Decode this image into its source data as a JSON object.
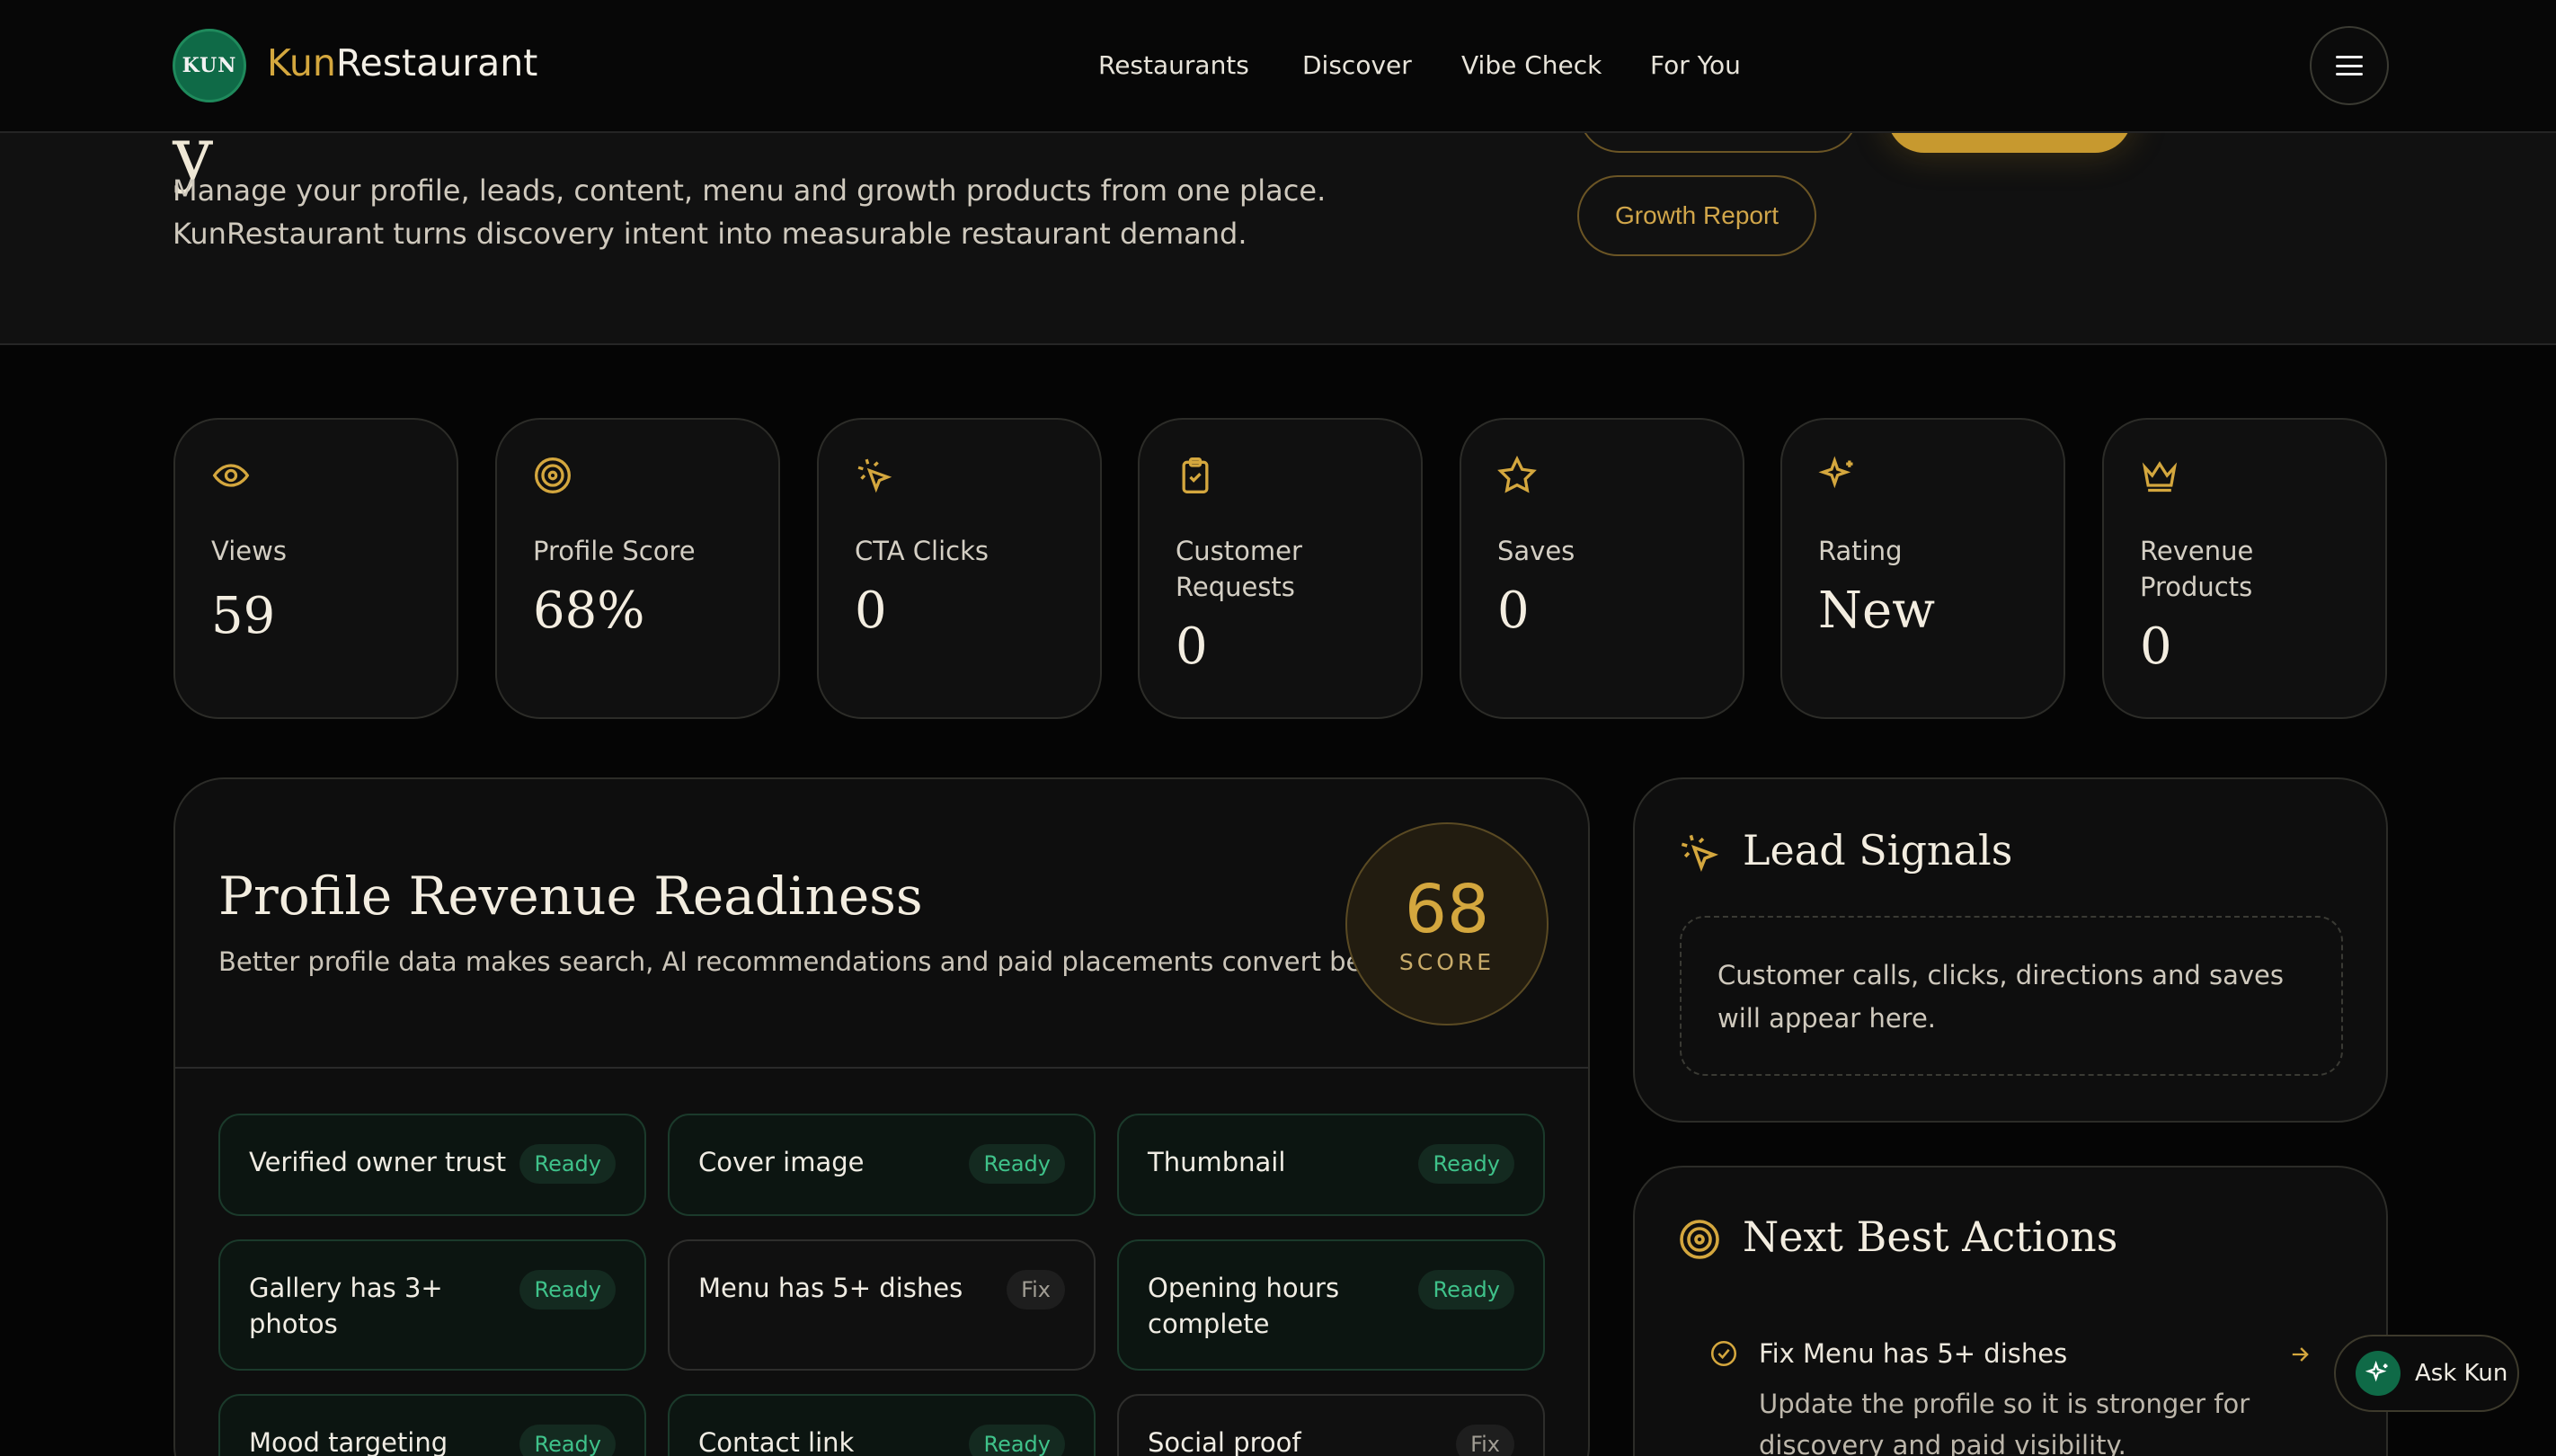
{
  "header": {
    "logo_text": "KUN",
    "brand_kun": "Kun",
    "brand_rest": "Restaurant",
    "nav": [
      "Restaurants",
      "Discover",
      "Vibe Check",
      "For You"
    ]
  },
  "hero": {
    "title_stub": "y",
    "description": "Manage your profile, leads, content, menu and growth products from one place. KunRestaurant turns discovery intent into measurable restaurant demand.",
    "growth_button": "Growth Report"
  },
  "stats": [
    {
      "icon": "eye-icon",
      "label": "Views",
      "value": "59"
    },
    {
      "icon": "target-icon",
      "label": "Profile Score",
      "value": "68%"
    },
    {
      "icon": "cursor-click-icon",
      "label": "CTA Clicks",
      "value": "0"
    },
    {
      "icon": "clipboard-check-icon",
      "label": "Customer Requests",
      "value": "0"
    },
    {
      "icon": "star-icon",
      "label": "Saves",
      "value": "0"
    },
    {
      "icon": "sparkles-icon",
      "label": "Rating",
      "value": "New"
    },
    {
      "icon": "crown-icon",
      "label": "Revenue Products",
      "value": "0"
    }
  ],
  "readiness": {
    "title": "Profile Revenue Readiness",
    "subtitle": "Better profile data makes search, AI recommendations and paid placements convert better.",
    "score": "68",
    "score_label": "SCORE",
    "checks": [
      {
        "label": "Verified owner trust",
        "status": "Ready"
      },
      {
        "label": "Cover image",
        "status": "Ready"
      },
      {
        "label": "Thumbnail",
        "status": "Ready"
      },
      {
        "label": "Gallery has 3+ photos",
        "status": "Ready"
      },
      {
        "label": "Menu has 5+ dishes",
        "status": "Fix"
      },
      {
        "label": "Opening hours complete",
        "status": "Ready"
      },
      {
        "label": "Mood targeting",
        "status": "Ready"
      },
      {
        "label": "Contact link",
        "status": "Ready"
      },
      {
        "label": "Social proof",
        "status": "Fix"
      }
    ]
  },
  "leads": {
    "title": "Lead Signals",
    "empty_text": "Customer calls, clicks, directions and saves will appear here."
  },
  "actions": {
    "title": "Next Best Actions",
    "item_title": "Fix Menu has 5+ dishes",
    "item_desc": "Update the profile so it is stronger for discovery and paid visibility."
  },
  "ask_kun": "Ask Kun",
  "colors": {
    "gold": "#d4a73e",
    "green": "#0f6a47",
    "ready": "#3fc28a",
    "background": "#050505"
  }
}
